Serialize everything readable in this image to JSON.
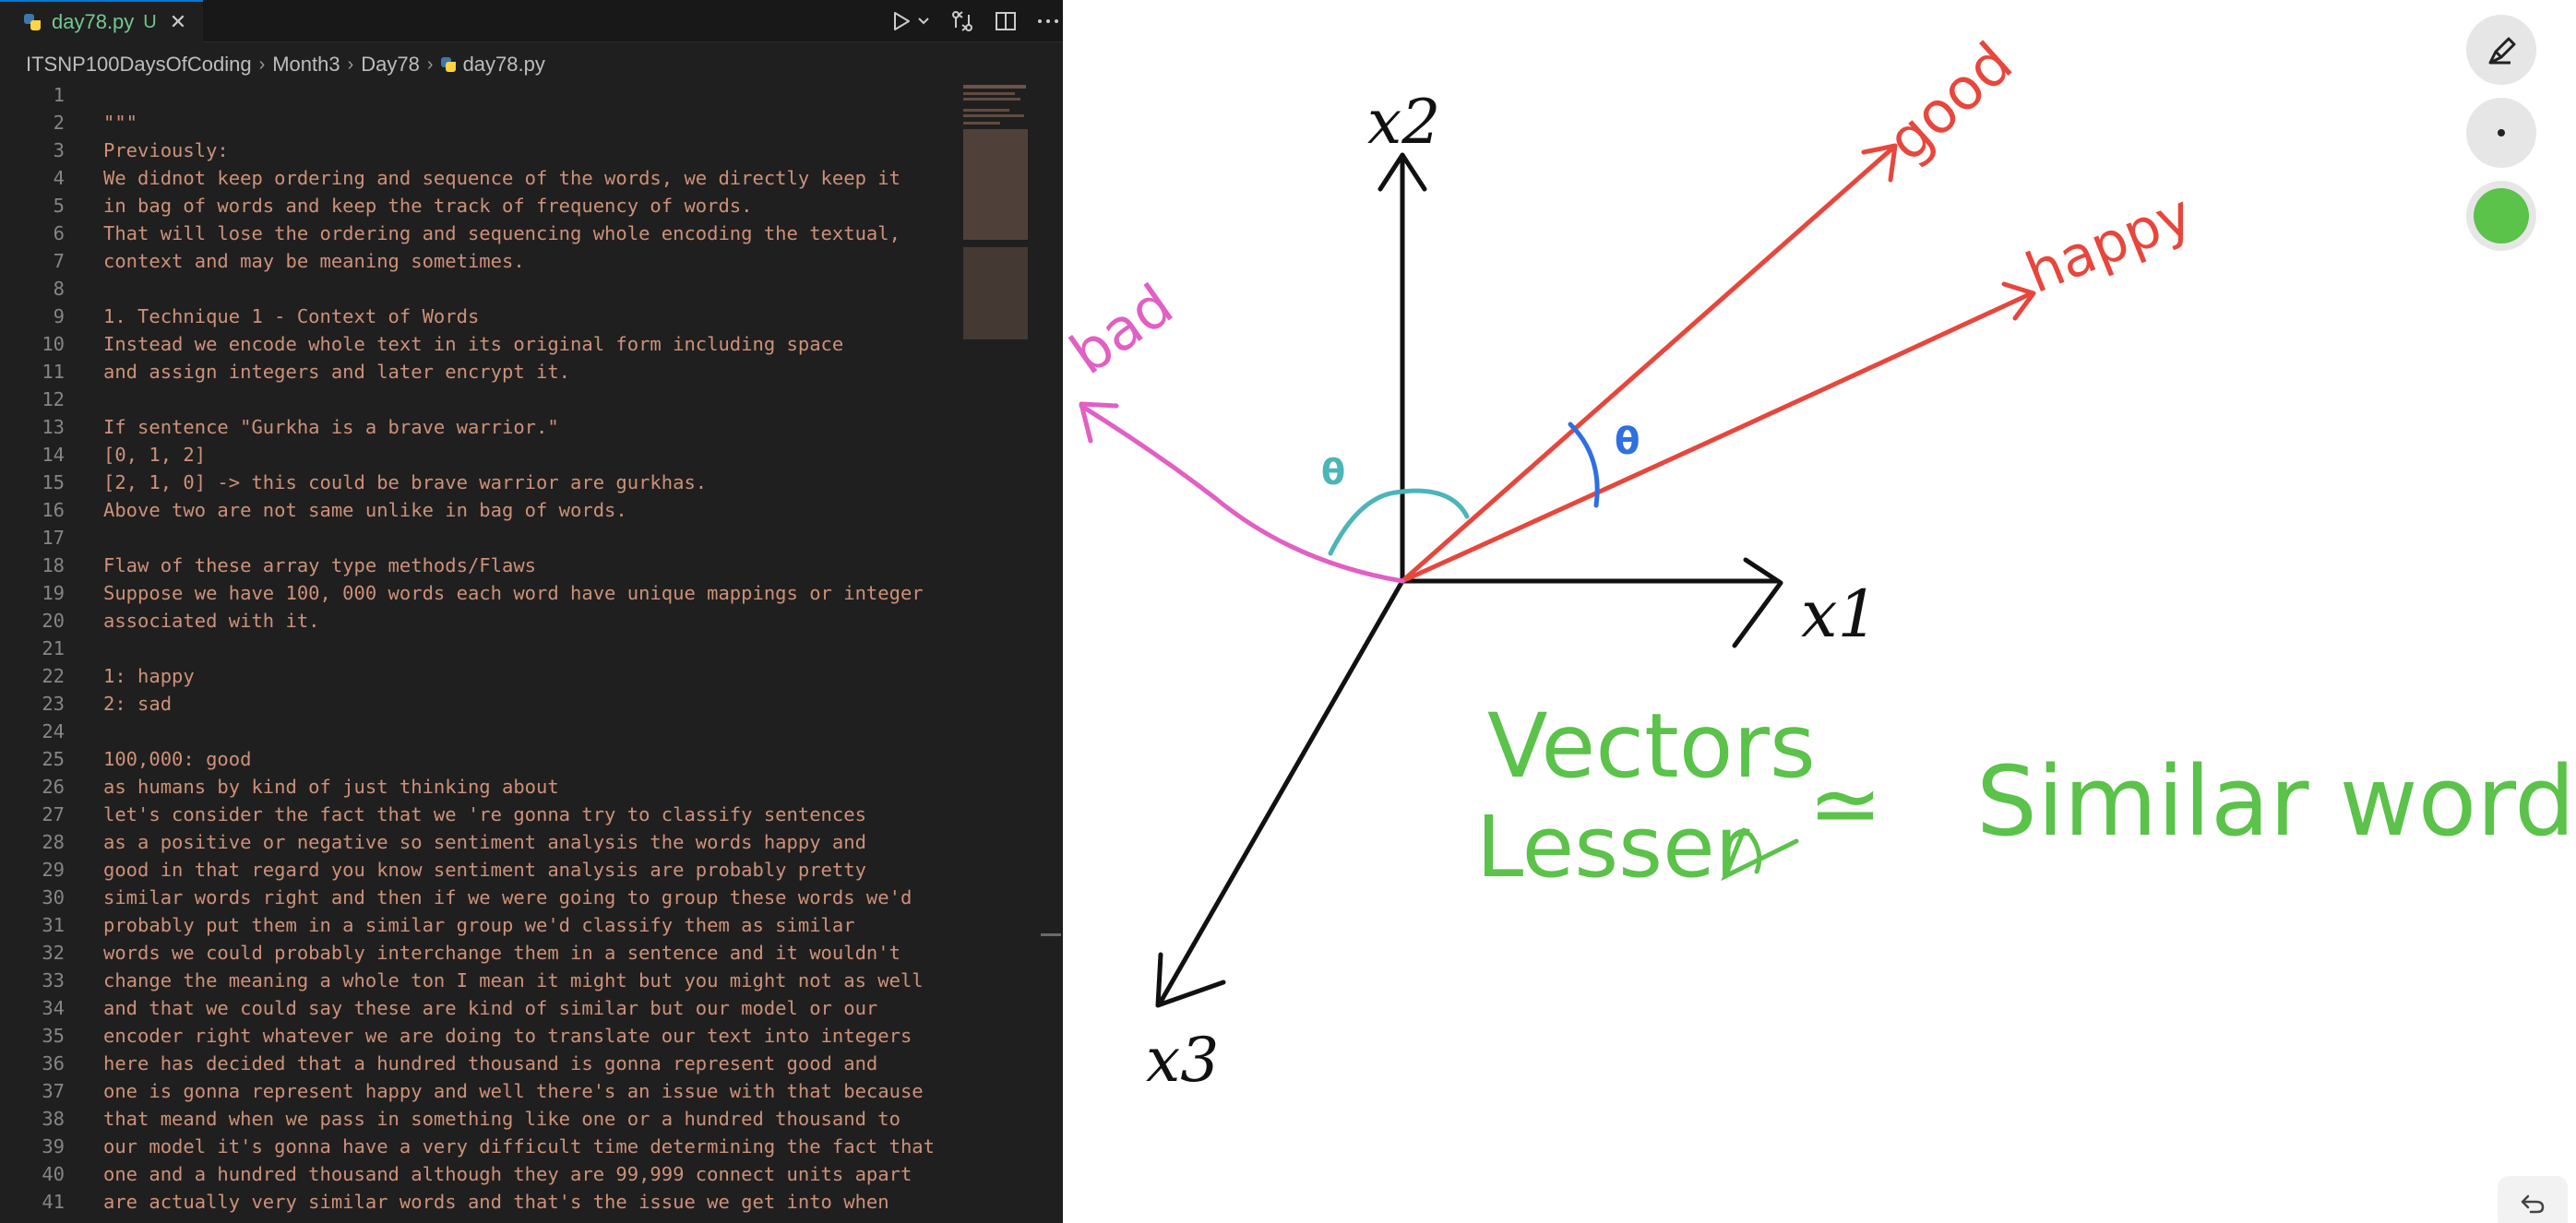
{
  "editor": {
    "tab": {
      "filename": "day78.py",
      "status": "U"
    },
    "breadcrumb": [
      "ITSNP100DaysOfCoding",
      "Month3",
      "Day78",
      "day78.py"
    ],
    "lines": [
      "",
      "\"\"\"",
      "Previously:",
      "We didnot keep ordering and sequence of the words, we directly keep it",
      "in bag of words and keep the track of frequency of words.",
      "That will lose the ordering and sequencing whole encoding the textual,",
      "context and may be meaning sometimes.",
      "",
      "1. Technique 1 - Context of Words",
      "Instead we encode whole text in its original form including space",
      "and assign integers and later encrypt it.",
      "",
      "If sentence \"Gurkha is a brave warrior.\"",
      "[0, 1, 2]",
      "[2, 1, 0] -> this could be brave warrior are gurkhas.",
      "Above two are not same unlike in bag of words.",
      "",
      "Flaw of these array type methods/Flaws",
      "Suppose we have 100, 000 words each word have unique mappings or integer",
      "associated with it.",
      "",
      "1: happy",
      "2: sad",
      "",
      "100,000: good",
      "as humans by kind of just thinking about",
      "let's consider the fact that we 're gonna try to classify sentences",
      "as a positive or negative so sentiment analysis the words happy and",
      "good in that regard you know sentiment analysis are probably pretty",
      "similar words right and then if we were going to group these words we'd",
      "probably put them in a similar group we'd classify them as similar",
      "words we could probably interchange them in a sentence and it wouldn't",
      "change the meaning a whole ton I mean it might but you might not as well",
      "and that we could say these are kind of similar but our model or our",
      "encoder right whatever we are doing to translate our text into integers",
      "here has decided that a hundred thousand is gonna represent good and",
      "one is gonna represent happy and well there's an issue with that because",
      "that meand when we pass in something like one or a hundred thousand to",
      "our model it's gonna have a very difficult time determining the fact that",
      "one and a hundred thousand although they are 99,999 connect units apart",
      "are actually very similar words and that's the issue we get into when"
    ]
  },
  "whiteboard": {
    "axes": {
      "x1": "x1",
      "x2": "x2",
      "x3": "x3"
    },
    "vectors": {
      "good": "good",
      "happy": "happy",
      "bad": "bad"
    },
    "angle_labels": {
      "small": "θ",
      "large": "θ"
    },
    "note_line1": "Vectors",
    "note_line2_left": "Lesser",
    "note_approx": "≃",
    "note_line2_right": "Similar words",
    "colors": {
      "ink": "#111111",
      "red": "#e8463c",
      "pink": "#e25fc3",
      "teal": "#4bb5b8",
      "blue": "#2f6fe0",
      "green": "#5bc24a"
    },
    "tools": {
      "pen_color": "#5bc24a"
    }
  },
  "colors": {
    "editor_bg": "#1f1f1f",
    "string_text": "#ce9178",
    "line_number": "#858585"
  }
}
